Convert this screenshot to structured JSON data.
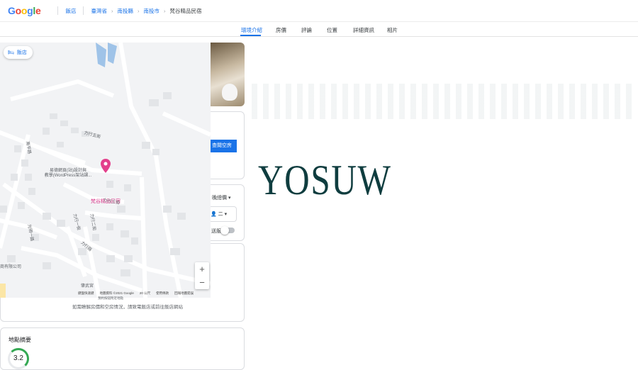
{
  "header": {
    "logo": "Google",
    "logo_colors": [
      "#4285F4",
      "#EA4335",
      "#FBBC05",
      "#4285F4",
      "#34A853",
      "#EA4335"
    ],
    "breadcrumbs": [
      "飯店",
      "臺灣省",
      "南投縣",
      "南投市",
      "梵谷精品民宿"
    ]
  },
  "tabs": [
    "環境介紹",
    "房價",
    "評論",
    "位置",
    "詳細資訊",
    "相片"
  ],
  "active_tab": "環境介紹",
  "map": {
    "chip_label": "飯店",
    "hotel_name": "梵谷精品民宿",
    "poi_label": "易德網頁(站)設計與\n教學(WordPress架站課...",
    "company_label": "商有限公司",
    "temple_label": "肇武宮",
    "street_labels": [
      "力行五街",
      "力行四街",
      "力行三街",
      "力行二街",
      "力行一街",
      "南平路",
      "光明一路",
      "力行路"
    ],
    "footer": [
      "鍵盤快速鍵",
      "地圖資料 ©2021 Google",
      "20 公尺",
      "使用條款",
      "回報地圖錯誤"
    ],
    "footer_sub": "預約按鈕附近地點",
    "zoom_in": "+",
    "zoom_out": "−"
  },
  "side_panel": {
    "book_button": "查閱空房",
    "price_option": "晚總價",
    "guests": "二",
    "toggle_label": "送服"
  },
  "note": "如需瞭解房價和空房情況，請致電飯店或前往飯店網站",
  "location_summary": {
    "title": "地點摘要",
    "score": "3.2"
  },
  "watermark": "YOSUW"
}
